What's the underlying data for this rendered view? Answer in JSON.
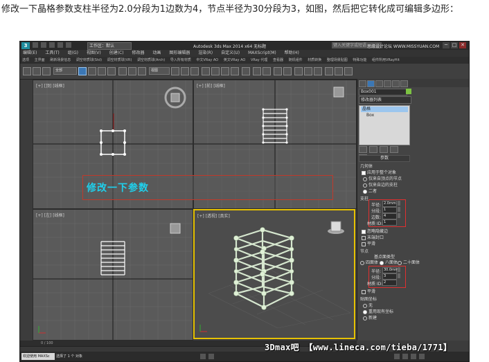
{
  "caption": "修改一下晶格参数支柱半径为2.0分段为1边数为4，节点半径为30分段为3，如图，然后把它转化成可编辑多边形：",
  "titlebar": {
    "logo": "3",
    "workspace": "工作区：默认",
    "title": "Autodesk 3ds Max  2014 x64     无标题",
    "search_placeholder": "键入关键字或短语",
    "min": "─",
    "max": "□",
    "close": "✕"
  },
  "menus": [
    "编辑(E)",
    "工具(T)",
    "组(G)",
    "视图(V)",
    "创建(C)",
    "修改器",
    "动画",
    "图形编辑器",
    "渲染(R)",
    "自定义(U)",
    "MAXScript(M)",
    "帮助(H)"
  ],
  "ribbon_items": [
    "选项",
    "主界面",
    "刷新场景信息",
    "调空材质球(Std)",
    "调空材质球(VR)",
    "调空材质球(Arch)",
    "导入所有材质",
    "中文VRay AO",
    "英文VRay AO",
    "VRay 代理",
    "查看器",
    "随机组件",
    "材质转换",
    "整理场景贴图",
    "特殊功能",
    "组件所用VRayHit"
  ],
  "toolbar": {
    "filter": "全部",
    "view": "视图"
  },
  "viewports": {
    "top": "[+] [顶] [线框]",
    "front": "[+] [前] [线框]",
    "left": "[+] [左] [线框]",
    "persp": "[+] [透视] [真实]"
  },
  "banner": "修改一下参数",
  "panel": {
    "object_name": "Box001",
    "modifier_list": "修改器列表",
    "stack": [
      "晶格",
      "Box"
    ],
    "params_title": "参数",
    "geometry_label": "几何体",
    "apply_all": "应用于整个对象",
    "only_joints": "仅来自顶点的节点",
    "only_struts": "仅来自边的支柱",
    "both": "二者",
    "struts_label": "支柱",
    "radius_label": "半径:",
    "strut_radius": "2.0mm",
    "segments_label": "分段:",
    "strut_segments": "1",
    "sides_label": "边数:",
    "strut_sides": "4",
    "material_label": "材质 ID:",
    "strut_material": "1",
    "ignore_hidden": "忽略隐藏边",
    "end_caps": "末端封口",
    "smooth": "平滑",
    "joints_label": "节点",
    "geodesic_label": "基点面类型",
    "tetra": "四面体",
    "octa": "八面体",
    "icosa": "二十面体",
    "joint_radius": "30.0mm",
    "joint_segments": "3",
    "joint_material": "2",
    "mapping_label": "贴图坐标",
    "map_none": "无",
    "map_reuse": "重用现有坐标",
    "map_new": "新建"
  },
  "timeline": "0 / 100",
  "status": {
    "left": "欢迎使用 MAXSc",
    "text": "选择了 1 个 对象"
  },
  "stamp": "思缘设计论坛 WWW.MISSYUAN.COM",
  "watermark": "3Dmax吧 【www.lineca.com/tieba/1771】"
}
